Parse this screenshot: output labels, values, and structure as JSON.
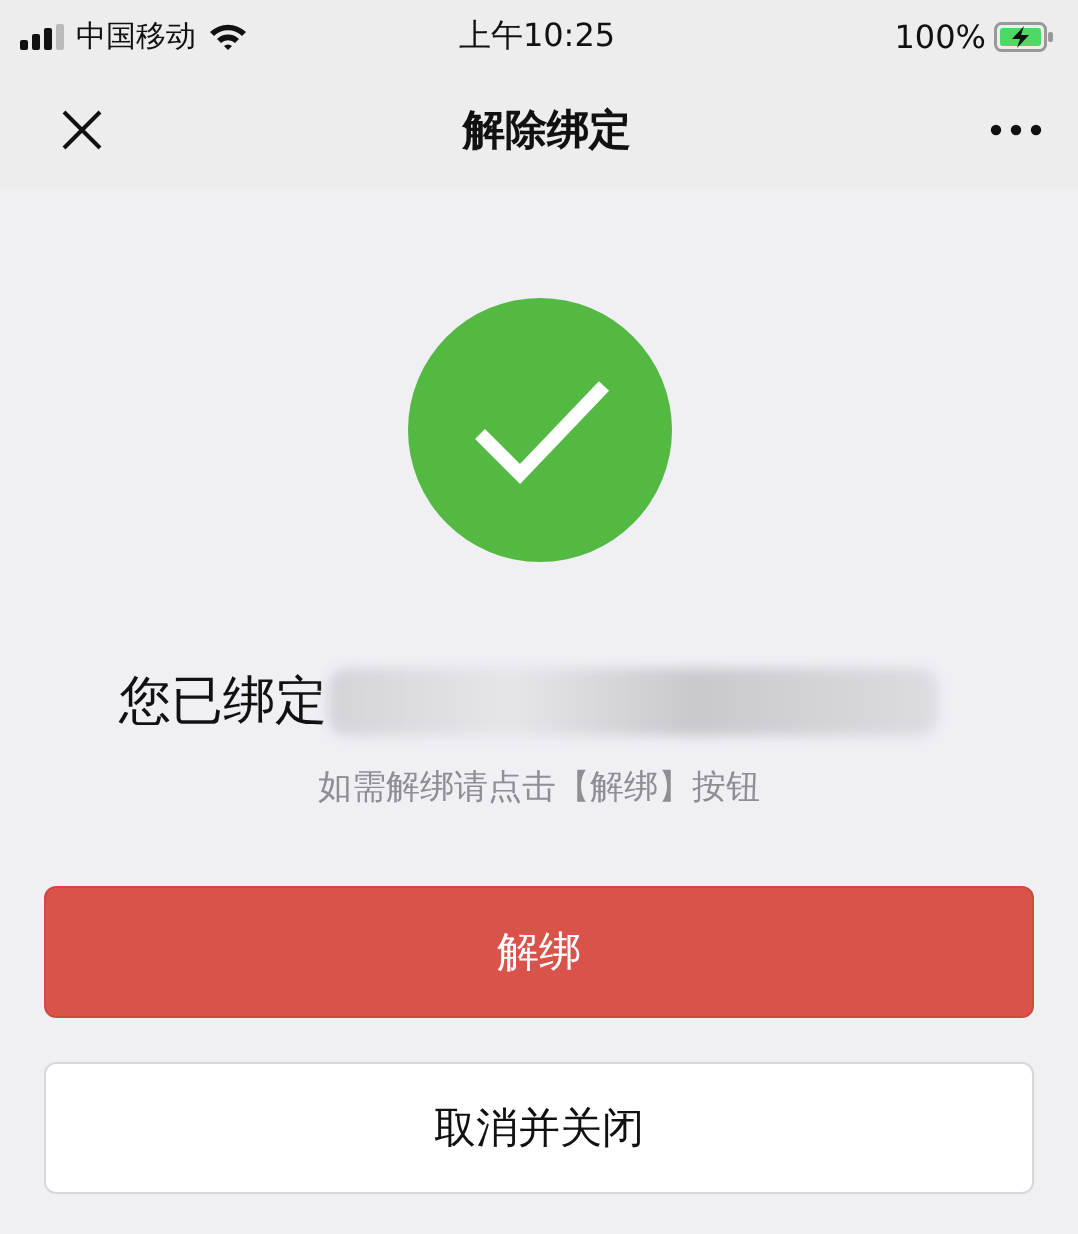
{
  "status_bar": {
    "carrier": "中国移动",
    "time": "上午10:25",
    "battery": "100%",
    "charging": true
  },
  "nav": {
    "title": "解除绑定"
  },
  "result": {
    "success": true,
    "message": "您已绑定",
    "redacted": true,
    "hint": "如需解绑请点击【解绑】按钮"
  },
  "buttons": [
    {
      "label": "解绑",
      "kind": "primary"
    },
    {
      "label": "取消并关闭",
      "kind": "default"
    }
  ]
}
